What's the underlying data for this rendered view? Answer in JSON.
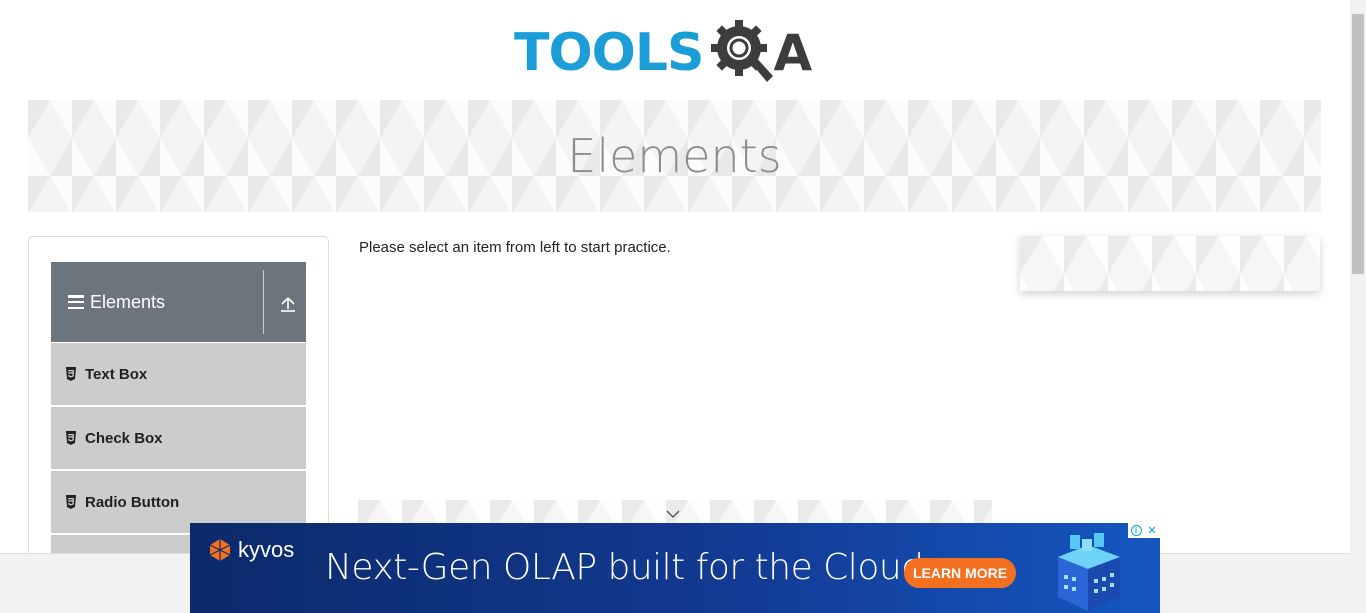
{
  "header": {
    "logo_text": "TOOLS",
    "logo_suffix": "A",
    "logo_gear_icon": "gear-magnifier-icon"
  },
  "banner": {
    "title": "Elements"
  },
  "sidebar": {
    "group": {
      "title": "Elements",
      "menu_icon": "hamburger-icon",
      "collapse_icon": "collapse-up-icon"
    },
    "items": [
      {
        "label": "Text Box",
        "icon": "html5-icon"
      },
      {
        "label": "Check Box",
        "icon": "html5-icon"
      },
      {
        "label": "Radio Button",
        "icon": "html5-icon"
      }
    ]
  },
  "main": {
    "instruction": "Please select an item from left to start practice."
  },
  "ad": {
    "brand": "kyvos",
    "headline": "Next-Gen OLAP built for the Cloud",
    "cta": "LEARN MORE",
    "info_icon": "adchoices-icon",
    "close_icon": "close-icon"
  },
  "colors": {
    "logo_blue": "#1b9ed8",
    "logo_dark": "#3d3d3d",
    "sidebar_header_bg": "#6c757d",
    "menu_item_bg": "#cccccc",
    "ad_bg": "#123a92",
    "ad_cta": "#f37021"
  }
}
